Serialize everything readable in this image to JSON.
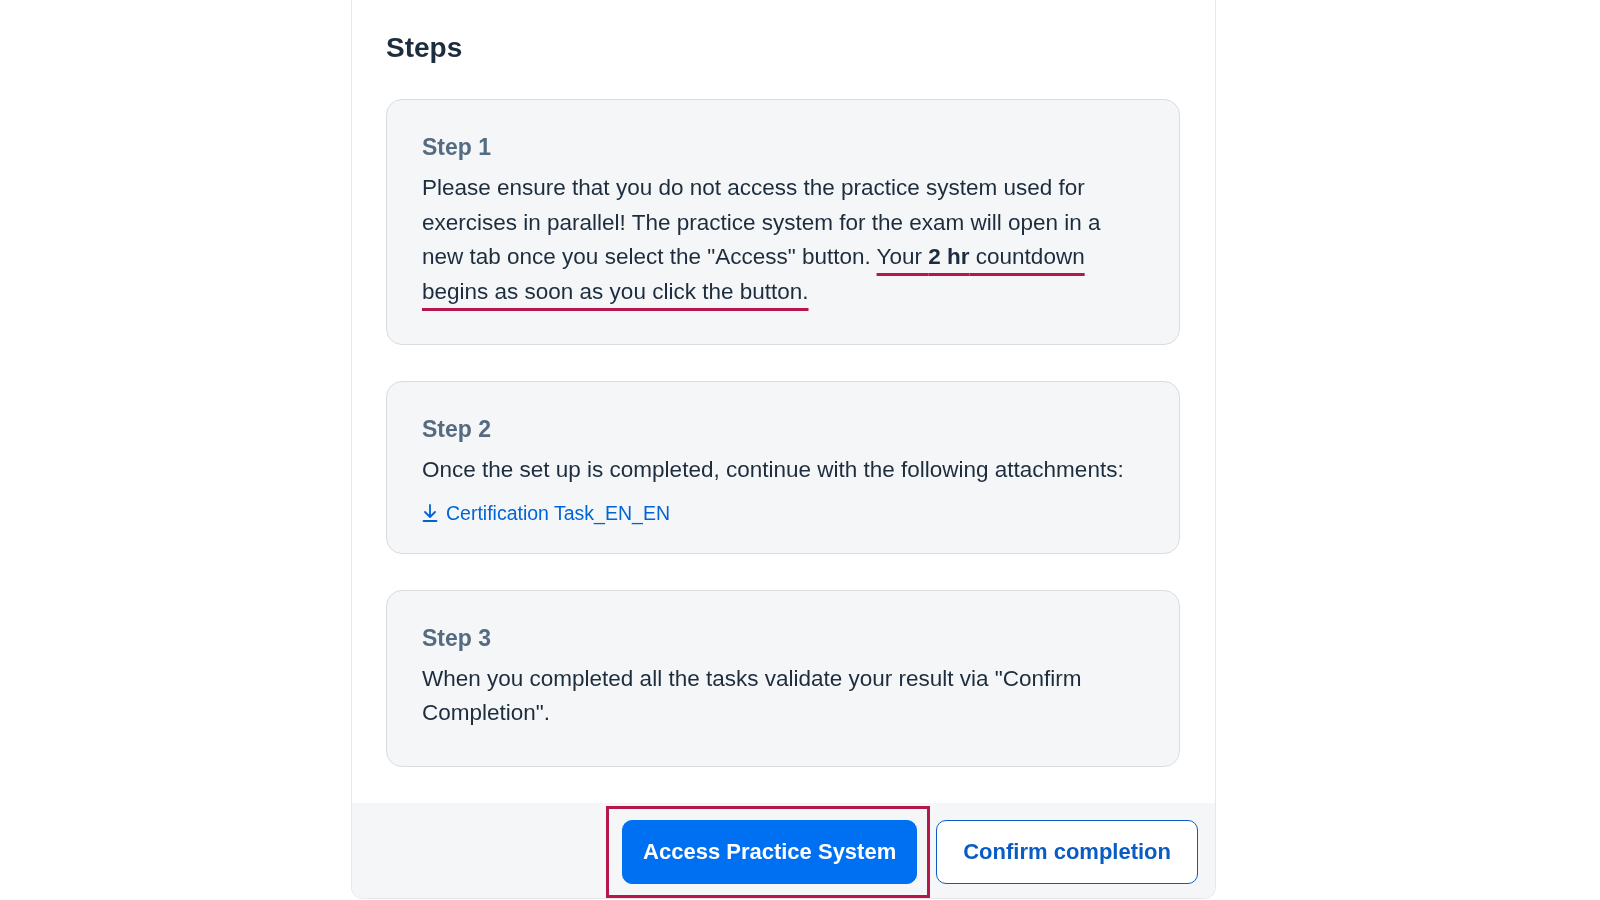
{
  "heading": "Steps",
  "steps": [
    {
      "title": "Step 1",
      "text": [
        {
          "text": "Please ensure that you do not access the practice system used for exercises in parallel! The practice system for the exam will open in a new tab once you select the \"Access\" button. ",
          "marked": false
        },
        {
          "text": "Your **2 hr** countdown begins as soon as you click the button.",
          "marked": true
        }
      ]
    },
    {
      "title": "Step 2",
      "text": [
        {
          "text": "Once the set up is completed, continue with the following attachments:",
          "marked": false
        }
      ],
      "attachments": [
        {
          "label": "Certification Task_EN_EN"
        }
      ]
    },
    {
      "title": "Step 3",
      "text": [
        {
          "text": "When you completed all the tasks validate your result via \"Confirm Completion\".",
          "marked": false
        }
      ]
    }
  ],
  "footer": {
    "buttons": [
      {
        "label": "Access Practice System",
        "kind": "primary",
        "highlighted": true
      },
      {
        "label": "Confirm completion",
        "kind": "secondary",
        "highlighted": false
      }
    ]
  }
}
